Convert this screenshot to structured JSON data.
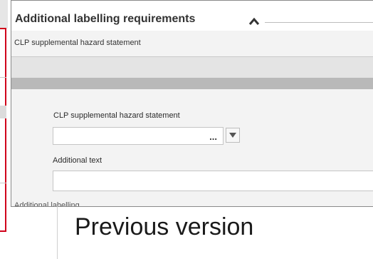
{
  "panel": {
    "title": "Additional labelling requirements",
    "collapse_icon": "chevron-up-icon",
    "subheading": "CLP supplemental hazard statement",
    "fields": {
      "clp_label": "CLP supplemental hazard statement",
      "clp_value": "",
      "clp_ellipsis": "...",
      "additional_text_label": "Additional text",
      "additional_text_value": ""
    },
    "next_section_clipped": "Additional labelling"
  },
  "caption": "Previous version",
  "colors": {
    "highlight_border": "#d0021b",
    "panel_background": "#f3f3f3",
    "band_gray": "#b9b9b9",
    "title_text": "#333333"
  }
}
